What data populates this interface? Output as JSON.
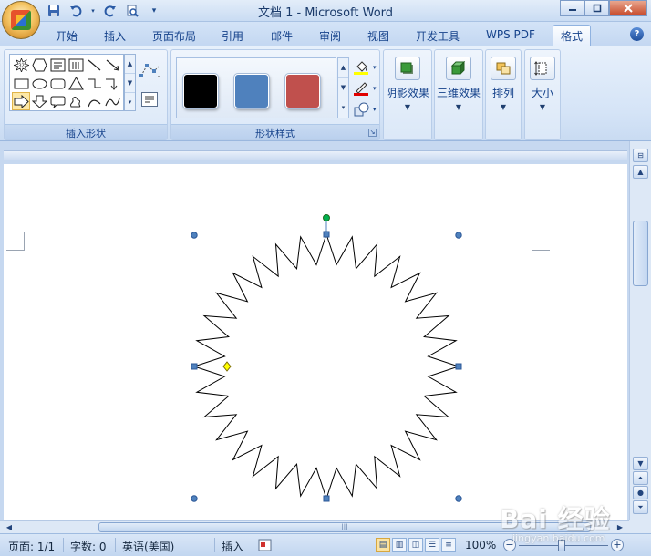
{
  "window": {
    "title": "文档 1 - Microsoft Word",
    "controls": [
      "minimize",
      "maximize",
      "close"
    ]
  },
  "quick_access": [
    "save-icon",
    "undo-icon",
    "redo-icon",
    "print-preview-icon",
    "customize-icon"
  ],
  "tabs": [
    {
      "label": "开始"
    },
    {
      "label": "插入"
    },
    {
      "label": "页面布局"
    },
    {
      "label": "引用"
    },
    {
      "label": "邮件"
    },
    {
      "label": "审阅"
    },
    {
      "label": "视图"
    },
    {
      "label": "开发工具"
    },
    {
      "label": "WPS PDF"
    },
    {
      "label": "格式",
      "active": true
    }
  ],
  "ribbon": {
    "insert_shapes": {
      "label": "插入形状",
      "shapes": [
        "star-32-icon",
        "hexagon-icon",
        "textbox-icon",
        "vertical-textbox-icon",
        "line-icon",
        "arrow-line-icon",
        "rectangle-icon",
        "oval-icon",
        "rounded-rectangle-icon",
        "triangle-icon",
        "elbow-connector-icon",
        "elbow-arrow-icon",
        "right-arrow-icon",
        "down-arrow-icon",
        "callout-icon",
        "freeform-icon",
        "arc-icon",
        "curve-icon"
      ],
      "star_badge": "32"
    },
    "shape_styles": {
      "label": "形状样式",
      "swatches": [
        "#000000",
        "#4f81bd",
        "#c0504d"
      ]
    },
    "shadow": {
      "label": "阴影效果"
    },
    "effects3d": {
      "label": "三维效果"
    },
    "arrange": {
      "label": "排列"
    },
    "size": {
      "label": "大小"
    }
  },
  "status": {
    "page": "页面: 1/1",
    "words": "字数: 0",
    "language": "英语(美国)",
    "mode": "插入",
    "zoom": "100%"
  },
  "watermark": {
    "main": "Bai 经验",
    "sub": "jingyan.baidu.com"
  },
  "colors": {
    "selection_handle": "#4f81bd",
    "rotation_handle": "#00b050",
    "adjust_handle": "#ffff00"
  }
}
